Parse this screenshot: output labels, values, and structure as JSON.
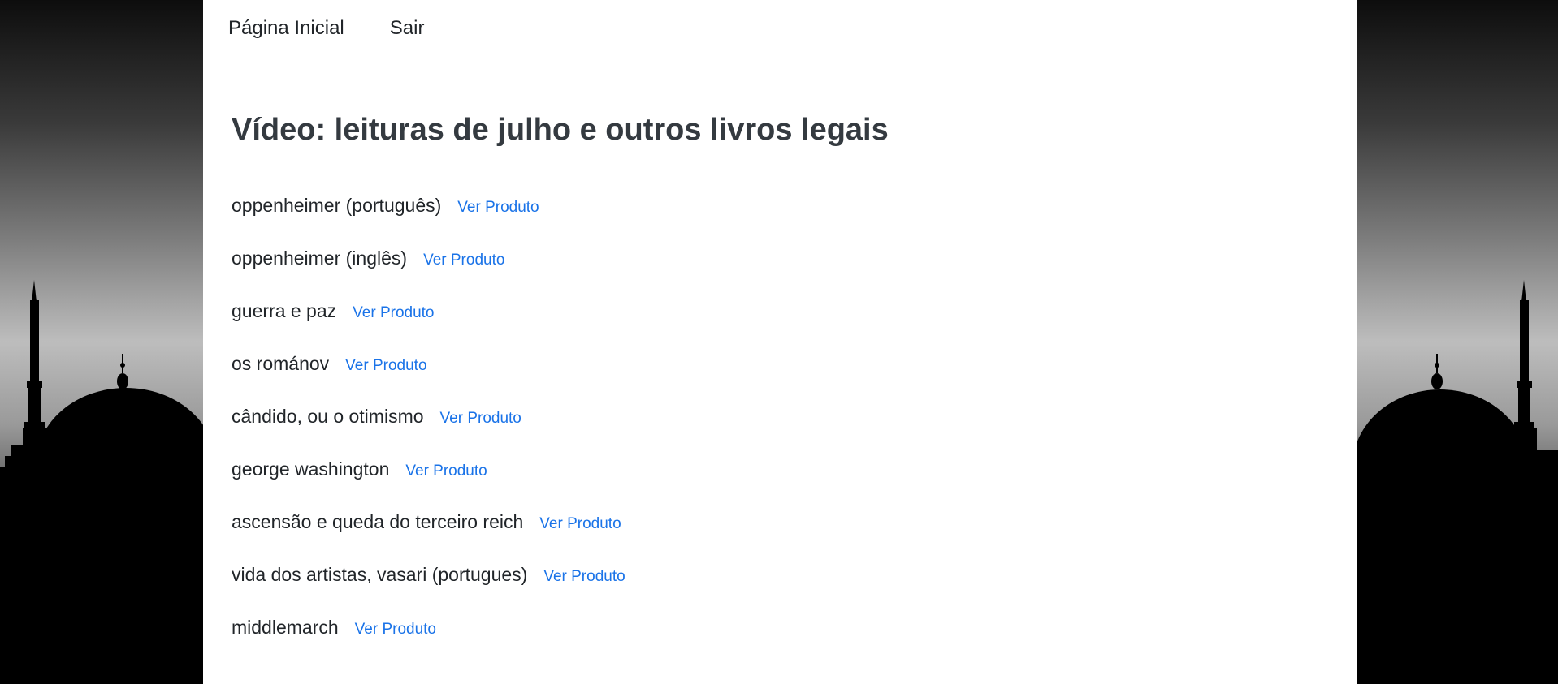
{
  "nav": {
    "items": [
      {
        "label": "Página Inicial"
      },
      {
        "label": "Sair"
      }
    ]
  },
  "page": {
    "title": "Vídeo: leituras de julho e outros livros legais"
  },
  "books": [
    {
      "title": "oppenheimer (português)",
      "link_label": "Ver Produto"
    },
    {
      "title": "oppenheimer (inglês)",
      "link_label": "Ver Produto"
    },
    {
      "title": "guerra e paz",
      "link_label": "Ver Produto"
    },
    {
      "title": "os románov",
      "link_label": "Ver Produto"
    },
    {
      "title": "cândido, ou o otimismo",
      "link_label": "Ver Produto"
    },
    {
      "title": "george washington",
      "link_label": "Ver Produto"
    },
    {
      "title": "ascensão e queda do terceiro reich",
      "link_label": "Ver Produto"
    },
    {
      "title": "vida dos artistas, vasari (portugues)",
      "link_label": "Ver Produto"
    },
    {
      "title": "middlemarch",
      "link_label": "Ver Produto"
    }
  ],
  "colors": {
    "link": "#1a73e8",
    "text": "#212529",
    "heading": "#343a40",
    "content_background": "#ffffff",
    "side_background": "#000000"
  },
  "background_image": {
    "icon": "mosque-silhouette"
  }
}
